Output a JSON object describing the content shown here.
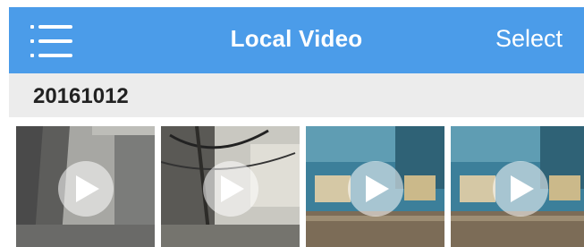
{
  "navbar": {
    "title": "Local Video",
    "select_label": "Select",
    "menu_icon": "hamburger-menu-icon",
    "bg_color": "#4b9ce9"
  },
  "section": {
    "date": "20161012"
  },
  "videos": [
    {
      "scene": "indoor-gray-wall",
      "icon": "play-icon"
    },
    {
      "scene": "cables-wall",
      "icon": "play-icon"
    },
    {
      "scene": "blue-room-boxes",
      "icon": "play-icon"
    },
    {
      "scene": "blue-room-boxes",
      "icon": "play-icon"
    }
  ]
}
